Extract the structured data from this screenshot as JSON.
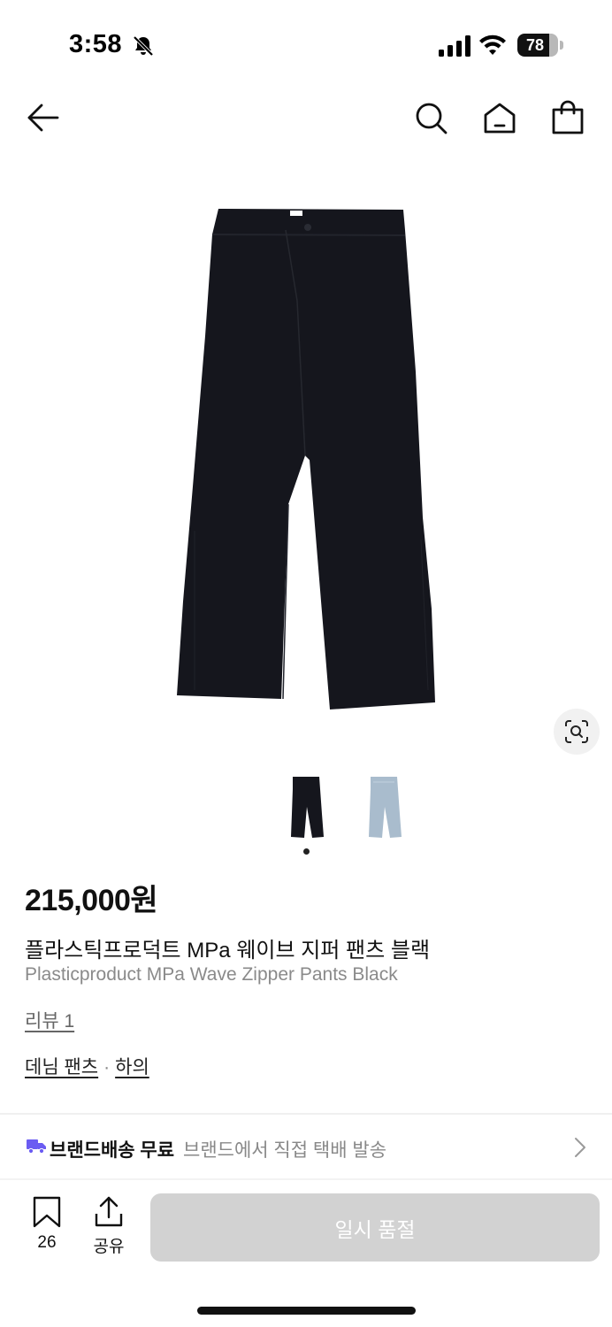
{
  "status_bar": {
    "time": "3:58",
    "battery_level": "78",
    "battery_fraction": 0.78,
    "icons": [
      "bell-slash-icon",
      "cellular-signal-icon",
      "wifi-icon",
      "battery-icon"
    ]
  },
  "nav": {
    "icons": [
      "back-arrow-icon",
      "search-icon",
      "home-icon",
      "shopping-bag-icon"
    ]
  },
  "product": {
    "price": "215,000원",
    "name_ko": "플라스틱프로덕트 MPa 웨이브 지퍼 팬츠 블랙",
    "name_en": "Plasticproduct MPa Wave Zipper Pants Black",
    "review_link": "리뷰 1",
    "category": {
      "primary": "데님 팬츠",
      "separator": "·",
      "secondary": "하의"
    },
    "variants": [
      {
        "color": "black",
        "selected": true
      },
      {
        "color": "light-blue",
        "selected": false
      }
    ]
  },
  "shipping": {
    "title": "브랜드배송 무료",
    "description": "브랜드에서 직접 택배 발송"
  },
  "bottom_bar": {
    "bookmark_count": "26",
    "share_label": "공유",
    "soldout_label": "일시 품절"
  },
  "colors": {
    "accent_purple": "#6b5cf2",
    "button_disabled": "#d2d2d2",
    "product_black": "#15161d",
    "product_light_blue": "#a9bccd"
  }
}
